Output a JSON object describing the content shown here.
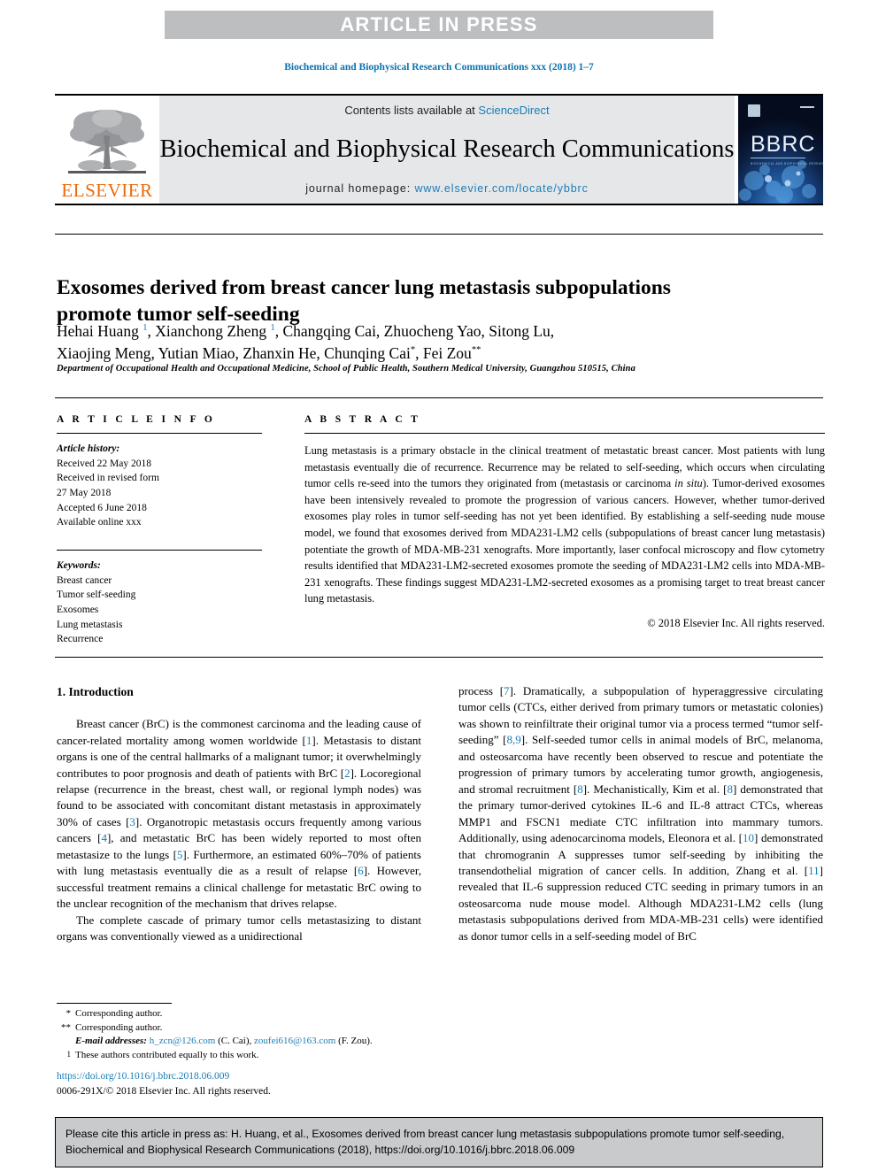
{
  "banner": {
    "text": "ARTICLE IN PRESS"
  },
  "running_head": "Biochemical and Biophysical Research Communications xxx (2018) 1–7",
  "masthead": {
    "publisher": "ELSEVIER",
    "contents_prefix": "Contents lists available at ",
    "contents_link": "ScienceDirect",
    "journal_title": "Biochemical and Biophysical Research Communications",
    "homepage_label": "journal homepage: ",
    "homepage_url": "www.elsevier.com/locate/ybbrc",
    "cover_title": "BBRC",
    "cover_subtitle": "BIOCHEMICAL AND BIOPHYSICAL RESEARCH COMMUNICATIONS"
  },
  "article": {
    "title": "Exosomes derived from breast cancer lung metastasis subpopulations promote tumor self-seeding",
    "authors_line1": "Hehai Huang ",
    "authors_line1_b": ", Xianchong Zheng ",
    "authors_line1_c": ", Changqing Cai, Zhuocheng Yao, Sitong Lu,",
    "authors_line2": "Xiaojing Meng, Yutian Miao, Zhanxin He, Chunqing Cai",
    "authors_line2_b": ", Fei Zou",
    "mark_one": "1",
    "mark_star": "*",
    "mark_dstar": "**",
    "affiliation": "Department of Occupational Health and Occupational Medicine, School of Public Health, Southern Medical University, Guangzhou 510515, China"
  },
  "info": {
    "heading": "A R T I C L E   I N F O",
    "history_label": "Article history:",
    "history": [
      "Received 22 May 2018",
      "Received in revised form",
      "27 May 2018",
      "Accepted 6 June 2018",
      "Available online xxx"
    ],
    "keywords_label": "Keywords:",
    "keywords": [
      "Breast cancer",
      "Tumor self-seeding",
      "Exosomes",
      "Lung metastasis",
      "Recurrence"
    ]
  },
  "abstract": {
    "heading": "A B S T R A C T",
    "part1": "Lung metastasis is a primary obstacle in the clinical treatment of metastatic breast cancer. Most patients with lung metastasis eventually die of recurrence. Recurrence may be related to self-seeding, which occurs when circulating tumor cells re-seed into the tumors they originated from (metastasis or carcinoma ",
    "italic": "in situ",
    "part2": "). Tumor-derived exosomes have been intensively revealed to promote the progression of various cancers. However, whether tumor-derived exosomes play roles in tumor self-seeding has not yet been identified. By establishing a self-seeding nude mouse model, we found that exosomes derived from MDA231-LM2 cells (subpopulations of breast cancer lung metastasis) potentiate the growth of MDA-MB-231 xenografts. More importantly, laser confocal microscopy and flow cytometry results identified that MDA231-LM2-secreted exosomes promote the seeding of MDA231-LM2 cells into MDA-MB-231 xenografts. These findings suggest MDA231-LM2-secreted exosomes as a promising target to treat breast cancer lung metastasis.",
    "copyright": "© 2018 Elsevier Inc. All rights reserved."
  },
  "intro": {
    "section_title": "1. Introduction",
    "left_p1_a": "Breast cancer (BrC) is the commonest carcinoma and the leading cause of cancer-related mortality among women worldwide [",
    "left_p1_r1": "1",
    "left_p1_b": "]. Metastasis to distant organs is one of the central hallmarks of a malignant tumor; it overwhelmingly contributes to poor prognosis and death of patients with BrC [",
    "left_p1_r2": "2",
    "left_p1_c": "]. Locoregional relapse (recurrence in the breast, chest wall, or regional lymph nodes) was found to be associated with concomitant distant metastasis in approximately 30% of cases [",
    "left_p1_r3": "3",
    "left_p1_d": "]. Organotropic metastasis occurs frequently among various cancers [",
    "left_p1_r4": "4",
    "left_p1_e": "], and metastatic BrC has been widely reported to most often metastasize to the lungs [",
    "left_p1_r5": "5",
    "left_p1_f": "]. Furthermore, an estimated 60%–70% of patients with lung metastasis eventually die as a result of relapse [",
    "left_p1_r6": "6",
    "left_p1_g": "]. However, successful treatment remains a clinical challenge for metastatic BrC owing to the unclear recognition of the mechanism that drives relapse.",
    "left_p2": "The complete cascade of primary tumor cells metastasizing to distant organs was conventionally viewed as a unidirectional",
    "right_p1_a": "process [",
    "right_p1_r7": "7",
    "right_p1_b": "]. Dramatically, a subpopulation of hyperaggressive circulating tumor cells (CTCs, either derived from primary tumors or metastatic colonies) was shown to reinfiltrate their original tumor via a process termed “tumor self-seeding” [",
    "right_p1_r89": "8,9",
    "right_p1_c": "]. Self-seeded tumor cells in animal models of BrC, melanoma, and osteosarcoma have recently been observed to rescue and potentiate the progression of primary tumors by accelerating tumor growth, angiogenesis, and stromal recruitment [",
    "right_p1_r8": "8",
    "right_p1_d": "]. Mechanistically, Kim et al. [",
    "right_p1_r8b": "8",
    "right_p1_e": "] demonstrated that the primary tumor-derived cytokines IL-6 and IL-8 attract CTCs, whereas MMP1 and FSCN1 mediate CTC infiltration into mammary tumors. Additionally, using adenocarcinoma models, Eleonora et al. [",
    "right_p1_r10": "10",
    "right_p1_f": "] demonstrated that chromogranin A suppresses tumor self-seeding by inhibiting the transendothelial migration of cancer cells. In addition, Zhang et al. [",
    "right_p1_r11": "11",
    "right_p1_g": "] revealed that IL-6 suppression reduced CTC seeding in primary tumors in an osteosarcoma nude mouse model. Although MDA231-LM2 cells (lung metastasis subpopulations derived from MDA-MB-231 cells) were identified as donor tumor cells in a self-seeding model of BrC"
  },
  "footnotes": {
    "star_mark": "*",
    "star_text": "Corresponding author.",
    "dstar_mark": "**",
    "dstar_text": "Corresponding author.",
    "email_label": "E-mail addresses:",
    "email1": "h_zcn@126.com",
    "email1_owner": " (C. Cai), ",
    "email2": "zoufei616@163.com",
    "email2_owner": " (F. Zou).",
    "one_mark": "1",
    "one_text": "These authors contributed equally to this work."
  },
  "doi_block": {
    "doi": "https://doi.org/10.1016/j.bbrc.2018.06.009",
    "issn_line": "0006-291X/© 2018 Elsevier Inc. All rights reserved."
  },
  "cite_box": {
    "text": "Please cite this article in press as: H. Huang, et al., Exosomes derived from breast cancer lung metastasis subpopulations promote tumor self-seeding, Biochemical and Biophysical Research Communications (2018), https://doi.org/10.1016/j.bbrc.2018.06.009"
  },
  "colors": {
    "link": "#1a7db6",
    "banner_bg": "#bdbec0",
    "masthead_bg": "#e6e7e8",
    "elsevier_orange": "#eb6a09",
    "cite_bg": "#c9cacc"
  }
}
